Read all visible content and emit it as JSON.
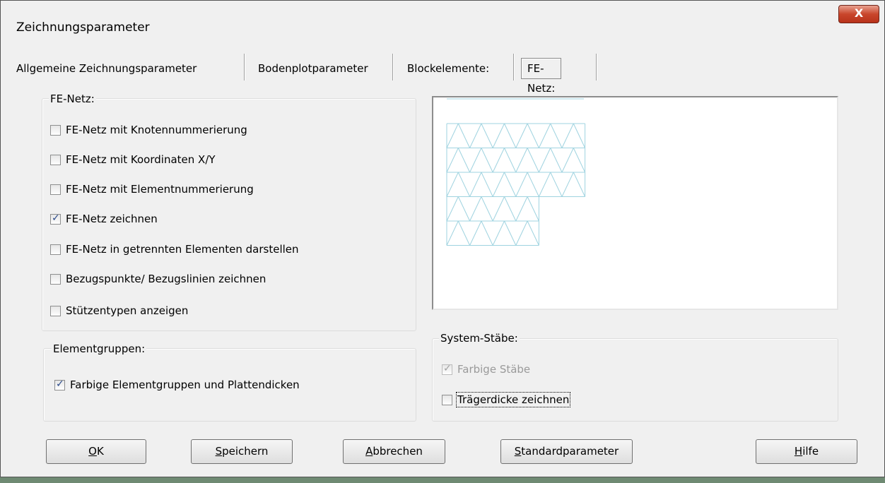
{
  "window": {
    "title": "Zeichnungsparameter",
    "close_label": "X"
  },
  "tabs": [
    {
      "label": "Allgemeine Zeichnungsparameter"
    },
    {
      "label": "Bodenplotparameter"
    },
    {
      "label": "Blockelemente:"
    },
    {
      "label": "FE-Netz:",
      "active": true
    }
  ],
  "fe_netz_group": {
    "label": "FE-Netz:",
    "options": [
      {
        "label": "FE-Netz mit Knotennummerierung",
        "checked": false
      },
      {
        "label": "FE-Netz mit Koordinaten X/Y",
        "checked": false
      },
      {
        "label": "FE-Netz mit Elementnummerierung",
        "checked": false
      },
      {
        "label": "FE-Netz zeichnen",
        "checked": true
      },
      {
        "label": "FE-Netz in getrennten Elementen darstellen",
        "checked": false
      },
      {
        "label": "Bezugspunkte/ Bezugslinien zeichnen",
        "checked": false
      },
      {
        "label": "Stützentypen anzeigen",
        "checked": false
      }
    ]
  },
  "elementgruppen_group": {
    "label": "Elementgruppen:",
    "option": {
      "label": "Farbige Elementgruppen und Plattendicken",
      "checked": true
    }
  },
  "system_staebe_group": {
    "label": "System-Stäbe:",
    "options": [
      {
        "label": "Farbige Stäbe",
        "checked": true,
        "disabled": true
      },
      {
        "label": "Trägerdicke zeichnen",
        "checked": false
      }
    ]
  },
  "buttons": {
    "ok": {
      "mnemonic": "O",
      "rest": "K"
    },
    "speichern": {
      "mnemonic": "S",
      "rest": "peichern"
    },
    "abbrechen": {
      "mnemonic": "A",
      "rest": "bbrechen"
    },
    "standardparameter": {
      "mnemonic": "S",
      "rest": "tandardparameter"
    },
    "hilfe": {
      "mnemonic": "H",
      "rest": "ilfe"
    }
  },
  "preview": {
    "mesh_color": "#9fd3e0"
  }
}
